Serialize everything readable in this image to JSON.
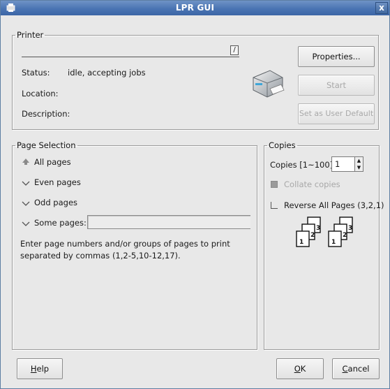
{
  "window": {
    "title": "LPR GUI",
    "close_glyph": "x"
  },
  "printer": {
    "legend": "Printer",
    "selected": "",
    "status_label": "Status:",
    "status_value": "idle, accepting jobs",
    "location_label": "Location:",
    "location_value": "",
    "description_label": "Description:",
    "description_value": "",
    "properties_button": "Properties...",
    "start_button": "Start",
    "set_default_button": "Set as User Default",
    "icon": "printer-icon"
  },
  "page_selection": {
    "legend": "Page Selection",
    "options": [
      {
        "label": "All pages",
        "selected": true
      },
      {
        "label": "Even pages",
        "selected": false
      },
      {
        "label": "Odd pages",
        "selected": false
      },
      {
        "label": "Some pages:",
        "selected": false
      }
    ],
    "some_pages_value": "",
    "help_text": "Enter page numbers and/or groups of pages to print separated by commas (1,2-5,10-12,17)."
  },
  "copies": {
    "legend": "Copies",
    "copies_label": "Copies [1~100]:",
    "copies_value": "1",
    "collate_label": "Collate copies",
    "collate_enabled": false,
    "reverse_label": "Reverse All Pages (3,2,1)",
    "reverse_checked": false,
    "icon": "collated-pages-icon",
    "page_numbers": [
      "3",
      "2",
      "1"
    ]
  },
  "footer": {
    "help_button": "Help",
    "help_mnemonic": "H",
    "ok_button": "OK",
    "ok_mnemonic": "O",
    "cancel_button": "Cancel",
    "cancel_mnemonic": "C"
  },
  "colors": {
    "titlebar": "#4a74b3",
    "window_bg": "#e8e8e8",
    "disabled_text": "#a8a8a8"
  }
}
